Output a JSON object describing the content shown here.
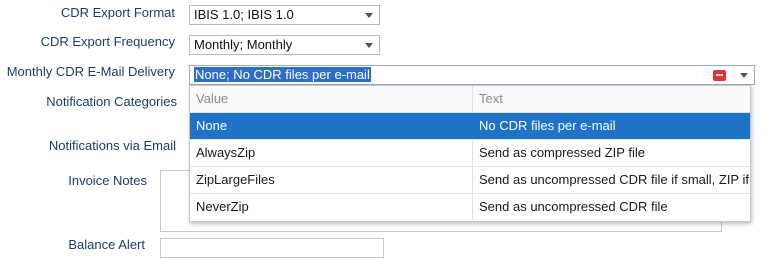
{
  "form": {
    "cdr_export_format": {
      "label": "CDR Export Format",
      "value": "IBIS 1.0; IBIS 1.0"
    },
    "cdr_export_frequency": {
      "label": "CDR Export Frequency",
      "value": "Monthly; Monthly"
    },
    "monthly_cdr_email_delivery": {
      "label": "Monthly CDR E-Mail Delivery",
      "value": "None; No CDR files per e-mail"
    },
    "notification_categories": {
      "label": "Notification Categories"
    },
    "notifications_via_email": {
      "label": "Notifications via Email"
    },
    "invoice_notes": {
      "label": "Invoice Notes"
    },
    "balance_alert": {
      "label": "Balance Alert"
    }
  },
  "dropdown": {
    "columns": [
      "Value",
      "Text"
    ],
    "rows": [
      {
        "value": "None",
        "text": "No CDR files per e-mail",
        "selected": true
      },
      {
        "value": "AlwaysZip",
        "text": "Send as compressed ZIP file",
        "selected": false
      },
      {
        "value": "ZipLargeFiles",
        "text": "Send as uncompressed CDR file if small, ZIP if",
        "selected": false
      },
      {
        "value": "NeverZip",
        "text": "Send as uncompressed CDR file",
        "selected": false
      }
    ]
  },
  "colors": {
    "selection": "#1e73c8",
    "label": "#1f3a6e",
    "error_icon": "#e03434"
  },
  "icons": {
    "dropdown_arrow": "chevron-down-icon",
    "error": "error-icon"
  }
}
